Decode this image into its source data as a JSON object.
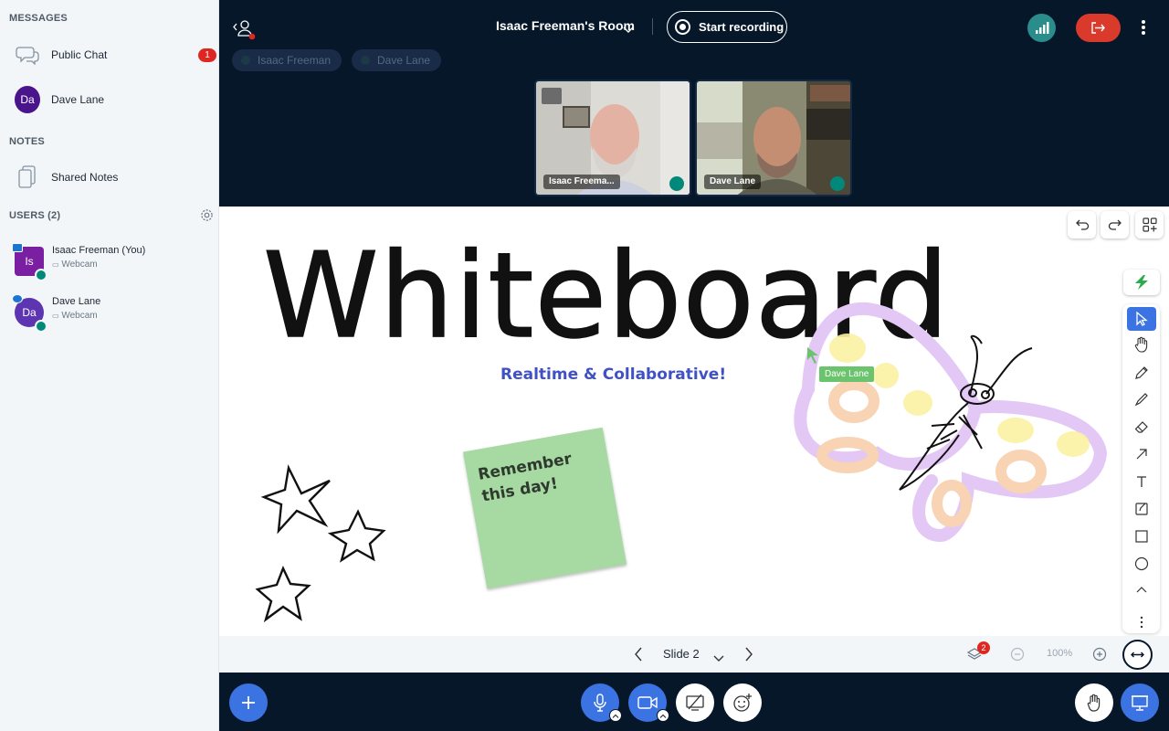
{
  "sidebar": {
    "messages_title": "MESSAGES",
    "public_chat": {
      "label": "Public Chat",
      "badge": "1"
    },
    "private_chat": {
      "initials": "Da",
      "label": "Dave Lane"
    },
    "notes_title": "NOTES",
    "shared_notes": {
      "label": "Shared Notes"
    },
    "users_title": "USERS (2)",
    "users": [
      {
        "initials": "Is",
        "name": "Isaac Freeman (You)",
        "sub": "Webcam"
      },
      {
        "initials": "Da",
        "name": "Dave Lane",
        "sub": "Webcam"
      }
    ]
  },
  "topbar": {
    "room_title": "Isaac Freeman's Room",
    "record_label": "Start recording",
    "talking": [
      "Isaac Freeman",
      "Dave Lane"
    ]
  },
  "videos": [
    {
      "name": "Isaac Freema..."
    },
    {
      "name": "Dave Lane"
    }
  ],
  "whiteboard": {
    "title": "Whiteboard",
    "subtitle": "Realtime & Collaborative!",
    "sticky_note": "Remember this day!",
    "cursor_label": "Dave Lane"
  },
  "navbar": {
    "slide_label": "Slide 2",
    "zoom_label": "100%",
    "notif_count": "2"
  },
  "colors": {
    "primary": "#3b73e3",
    "dark_bg": "#06172a",
    "danger": "#d93a2b",
    "sticky": "#a7d9a2",
    "subtitle": "#3f51c4"
  }
}
